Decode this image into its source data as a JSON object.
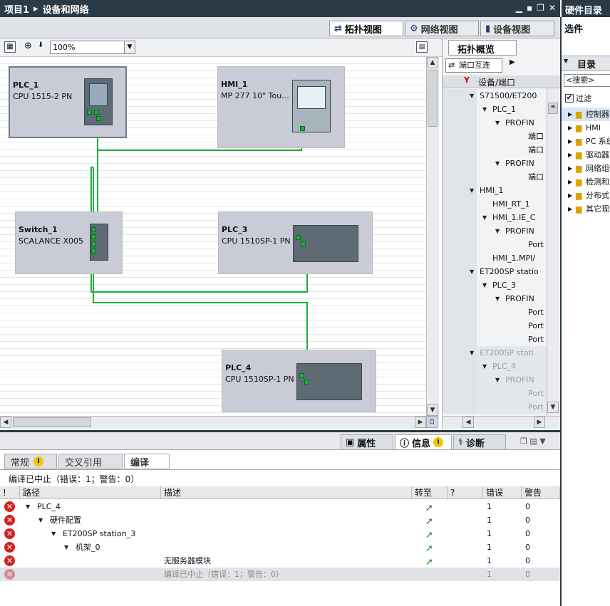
{
  "window": {
    "breadcrumb": [
      "项目1",
      "设备和网络"
    ],
    "controls": [
      "▁",
      "▪",
      "❐",
      "✕"
    ]
  },
  "hw_catalog": {
    "title": "硬件目录",
    "options": "选件",
    "catalog": "目录",
    "search_placeholder": "<搜索>",
    "filter": "过滤",
    "items": [
      "控制器",
      "HMI",
      "PC 系统",
      "驱动器",
      "网络组件",
      "检测和监视",
      "分布式 I/O",
      "其它现场设备"
    ]
  },
  "view_tabs": [
    "拓扑视图",
    "网络视图",
    "设备视图"
  ],
  "toolbar": {
    "zoom": "100%"
  },
  "devices": [
    {
      "name": "PLC_1",
      "type": "CPU 1515-2 PN"
    },
    {
      "name": "HMI_1",
      "type": "MP 277 10\" Tou..."
    },
    {
      "name": "Switch_1",
      "type": "SCALANCE X005"
    },
    {
      "name": "PLC_3",
      "type": "CPU 1510SP-1 PN"
    },
    {
      "name": "PLC_4",
      "type": "CPU 1510SP-1 PN"
    }
  ],
  "overview": {
    "tab": "拓扑概览",
    "port_button": "端口互连",
    "column": "设备/端口",
    "rows": [
      {
        "label": "S71500/ET200",
        "indent": 0,
        "arrow": true
      },
      {
        "label": "PLC_1",
        "indent": 1,
        "arrow": true
      },
      {
        "label": "PROFIN",
        "indent": 2,
        "arrow": true
      },
      {
        "label": "端口",
        "indent": 3,
        "arrow": false
      },
      {
        "label": "端口",
        "indent": 3,
        "arrow": false
      },
      {
        "label": "PROFIN",
        "indent": 2,
        "arrow": true
      },
      {
        "label": "端口",
        "indent": 3,
        "arrow": false
      },
      {
        "label": "HMI_1",
        "indent": 0,
        "arrow": true
      },
      {
        "label": "HMI_RT_1",
        "indent": 1,
        "arrow": false
      },
      {
        "label": "HMI_1.IE_C",
        "indent": 1,
        "arrow": true
      },
      {
        "label": "PROFIN",
        "indent": 2,
        "arrow": true
      },
      {
        "label": "Port",
        "indent": 3,
        "arrow": false
      },
      {
        "label": "HMI_1.MPI/",
        "indent": 1,
        "arrow": false
      },
      {
        "label": "ET200SP statio",
        "indent": 0,
        "arrow": true
      },
      {
        "label": "PLC_3",
        "indent": 1,
        "arrow": true
      },
      {
        "label": "PROFIN",
        "indent": 2,
        "arrow": true
      },
      {
        "label": "Port",
        "indent": 3,
        "arrow": false
      },
      {
        "label": "Port",
        "indent": 3,
        "arrow": false
      },
      {
        "label": "Port",
        "indent": 3,
        "arrow": false
      },
      {
        "label": "ET200SP stati",
        "indent": 0,
        "arrow": true,
        "dim": true
      },
      {
        "label": "PLC_4",
        "indent": 1,
        "arrow": true,
        "dim": true
      },
      {
        "label": "PROFIN",
        "indent": 2,
        "arrow": true,
        "dim": true
      },
      {
        "label": "Port",
        "indent": 3,
        "arrow": false,
        "dim": true
      },
      {
        "label": "Port",
        "indent": 3,
        "arrow": false,
        "dim": true
      }
    ]
  },
  "inspector": {
    "tabs": [
      "属性",
      "信息",
      "诊断"
    ],
    "subtabs": [
      "常规",
      "交叉引用",
      "编译"
    ],
    "status": "编译已中止（错误：1；警告：0）",
    "columns": [
      "!",
      "路径",
      "描述",
      "转至",
      "?",
      "错误",
      "警告"
    ],
    "rows": [
      {
        "path": "PLC_4",
        "indent": 1,
        "arrow": true,
        "desc": "",
        "errors": "1",
        "warnings": "0",
        "dim": false
      },
      {
        "path": "硬件配置",
        "indent": 2,
        "arrow": true,
        "desc": "",
        "errors": "1",
        "warnings": "0",
        "dim": false
      },
      {
        "path": "ET200SP station_3",
        "indent": 3,
        "arrow": true,
        "desc": "",
        "errors": "1",
        "warnings": "0",
        "dim": false
      },
      {
        "path": "机架_0",
        "indent": 4,
        "arrow": true,
        "desc": "",
        "errors": "1",
        "warnings": "0",
        "dim": false
      },
      {
        "path": "",
        "indent": 0,
        "arrow": false,
        "desc": "无服务器模块",
        "errors": "1",
        "warnings": "0",
        "dim": false
      },
      {
        "path": "",
        "indent": 0,
        "arrow": false,
        "desc": "编译已中止（错误：1；警告：0）",
        "errors": "1",
        "warnings": "0",
        "dim": true
      }
    ]
  },
  "colors": {
    "titlebar": "#2a3a47",
    "link": "#1fae3b",
    "device": "#c9ccd6",
    "error": "#d42020"
  }
}
